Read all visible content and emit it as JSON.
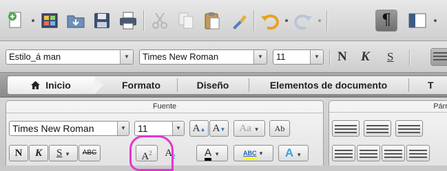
{
  "standard_toolbar": {
    "icons": [
      "new-document-icon",
      "templates-gallery-icon",
      "open-icon",
      "save-icon",
      "print-icon",
      "cut-icon",
      "copy-icon",
      "paste-icon",
      "format-painter-icon",
      "undo-icon",
      "redo-icon",
      "show-formatting-icon",
      "sidebar-icon"
    ],
    "pilcrow": "¶"
  },
  "format_bar": {
    "style_value": "Estilo_á man",
    "font_value": "Times New Roman",
    "size_value": "11",
    "bold": "N",
    "italic": "K",
    "underline": "S"
  },
  "ribbon_tabs": [
    {
      "label": "Inicio",
      "active": true
    },
    {
      "label": "Formato"
    },
    {
      "label": "Diseño"
    },
    {
      "label": "Elementos de documento"
    },
    {
      "label": "T"
    }
  ],
  "ribbon": {
    "fuente_title": "Fuente",
    "parrafo_title": "Párr",
    "font_value": "Times New Roman",
    "size_value": "11",
    "grow_label": "A",
    "shrink_label": "A",
    "change_case_label": "Aa",
    "clear_format_label": "Ab",
    "bold": "N",
    "italic": "K",
    "underline": "S",
    "strike": "ABC",
    "superscript_base": "A",
    "superscript_mark": "2",
    "subscript_base": "A",
    "subscript_mark": "2",
    "font_color_label": "A",
    "highlight_label": "ABC",
    "text_effects_label": "A"
  },
  "colors": {
    "annotation": "#e535d1",
    "font_color_bar": "#000000",
    "highlight_bar": "#ffff00",
    "text_effects": "#3aa0e0"
  }
}
